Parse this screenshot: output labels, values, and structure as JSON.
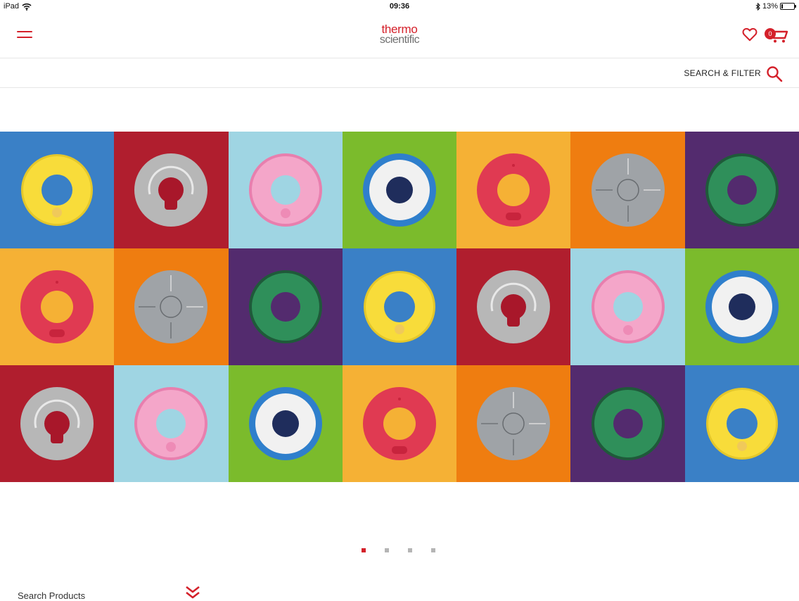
{
  "status_bar": {
    "device": "iPad",
    "time": "09:36",
    "battery_pct": "13%",
    "battery_level": 0.13,
    "icons": [
      "wifi-icon",
      "bluetooth-icon",
      "battery-icon"
    ]
  },
  "header": {
    "logo_line1": "thermo",
    "logo_line2": "scientific",
    "cart_count": "0",
    "icons": [
      "menu-icon",
      "heart-icon",
      "cart-icon"
    ]
  },
  "search_bar": {
    "label": "SEARCH & FILTER",
    "icon": "search-icon"
  },
  "hero": {
    "rows": [
      [
        {
          "bg": "#3a80c6",
          "kind": "yellow"
        },
        {
          "bg": "#b01e2e",
          "kind": "gray"
        },
        {
          "bg": "#9fd5e3",
          "kind": "pink"
        },
        {
          "bg": "#7bbb2c",
          "kind": "blue"
        },
        {
          "bg": "#f5b135",
          "kind": "red"
        },
        {
          "bg": "#ef7d10",
          "kind": "cross"
        },
        {
          "bg": "#532b6e",
          "kind": "green"
        }
      ],
      [
        {
          "bg": "#f5b135",
          "kind": "red"
        },
        {
          "bg": "#ef7d10",
          "kind": "cross"
        },
        {
          "bg": "#532b6e",
          "kind": "green"
        },
        {
          "bg": "#3a80c6",
          "kind": "yellow"
        },
        {
          "bg": "#b01e2e",
          "kind": "gray"
        },
        {
          "bg": "#9fd5e3",
          "kind": "pink"
        },
        {
          "bg": "#7bbb2c",
          "kind": "blue"
        }
      ],
      [
        {
          "bg": "#b01e2e",
          "kind": "gray"
        },
        {
          "bg": "#9fd5e3",
          "kind": "pink"
        },
        {
          "bg": "#7bbb2c",
          "kind": "blue"
        },
        {
          "bg": "#f5b135",
          "kind": "red"
        },
        {
          "bg": "#ef7d10",
          "kind": "cross"
        },
        {
          "bg": "#532b6e",
          "kind": "green"
        },
        {
          "bg": "#3a80c6",
          "kind": "yellow"
        }
      ]
    ]
  },
  "carousel": {
    "count": 4,
    "active": 0
  },
  "bottom": {
    "search_products": "Search Products",
    "icon": "double-chevron-down-icon"
  },
  "colors": {
    "brand_red": "#d4202a",
    "logo_gray": "#6f6f6f"
  }
}
